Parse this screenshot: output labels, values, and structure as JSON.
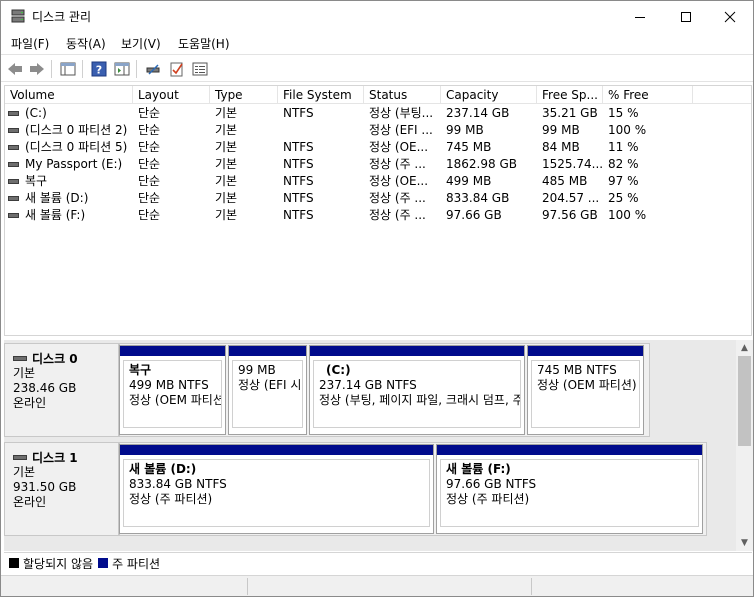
{
  "window": {
    "title": "디스크 관리"
  },
  "menu": [
    "파일(F)",
    "동작(A)",
    "보기(V)",
    "도움말(H)"
  ],
  "toolbar": {
    "icons": [
      "back-arrow-icon",
      "forward-arrow-icon",
      "console-tree-icon",
      "help-icon",
      "action-pane-icon",
      "connect-icon",
      "checklist-icon",
      "properties-icon"
    ]
  },
  "columns": [
    "Volume",
    "Layout",
    "Type",
    "File System",
    "Status",
    "Capacity",
    "Free Sp...",
    "% Free"
  ],
  "volumes": [
    {
      "volume": "(C:)",
      "layout": "단순",
      "type": "기본",
      "fs": "NTFS",
      "status": "정상 (부팅...",
      "capacity": "237.14 GB",
      "free": "35.21 GB",
      "pct": "15 %"
    },
    {
      "volume": "(디스크 0 파티션 2)",
      "layout": "단순",
      "type": "기본",
      "fs": "",
      "status": "정상 (EFI ...",
      "capacity": "99 MB",
      "free": "99 MB",
      "pct": "100 %"
    },
    {
      "volume": "(디스크 0 파티션 5)",
      "layout": "단순",
      "type": "기본",
      "fs": "NTFS",
      "status": "정상 (OE...",
      "capacity": "745 MB",
      "free": "84 MB",
      "pct": "11 %"
    },
    {
      "volume": "My Passport (E:)",
      "layout": "단순",
      "type": "기본",
      "fs": "NTFS",
      "status": "정상 (주 ...",
      "capacity": "1862.98 GB",
      "free": "1525.74...",
      "pct": "82 %"
    },
    {
      "volume": "복구",
      "layout": "단순",
      "type": "기본",
      "fs": "NTFS",
      "status": "정상 (OE...",
      "capacity": "499 MB",
      "free": "485 MB",
      "pct": "97 %"
    },
    {
      "volume": "새 볼륨 (D:)",
      "layout": "단순",
      "type": "기본",
      "fs": "NTFS",
      "status": "정상 (주 ...",
      "capacity": "833.84 GB",
      "free": "204.57 ...",
      "pct": "25 %"
    },
    {
      "volume": "새 볼륨 (F:)",
      "layout": "단순",
      "type": "기본",
      "fs": "NTFS",
      "status": "정상 (주 ...",
      "capacity": "97.66 GB",
      "free": "97.56 GB",
      "pct": "100 %"
    }
  ],
  "disks": [
    {
      "name": "디스크 0",
      "type": "기본",
      "size": "238.46 GB",
      "state": "온라인",
      "partitions": [
        {
          "name": "복구",
          "size": "499 MB NTFS",
          "status": "정상 (OEM 파티션)"
        },
        {
          "name": "",
          "size": "99 MB",
          "status": "정상 (EFI 시스템 파티션)"
        },
        {
          "name": "(C:)",
          "size": "237.14 GB NTFS",
          "status": "정상 (부팅, 페이지 파일, 크래시 덤프, 주 파티션)"
        },
        {
          "name": "",
          "size": "745 MB NTFS",
          "status": "정상 (OEM 파티션)"
        }
      ]
    },
    {
      "name": "디스크 1",
      "type": "기본",
      "size": "931.50 GB",
      "state": "온라인",
      "partitions": [
        {
          "name": "새 볼륨  (D:)",
          "size": "833.84 GB NTFS",
          "status": "정상 (주 파티션)"
        },
        {
          "name": "새 볼륨  (F:)",
          "size": "97.66 GB NTFS",
          "status": "정상 (주 파티션)"
        }
      ]
    }
  ],
  "legend": [
    {
      "label": "할당되지 않음",
      "color": "#000000"
    },
    {
      "label": "주 파티션",
      "color": "#000b8c"
    }
  ]
}
